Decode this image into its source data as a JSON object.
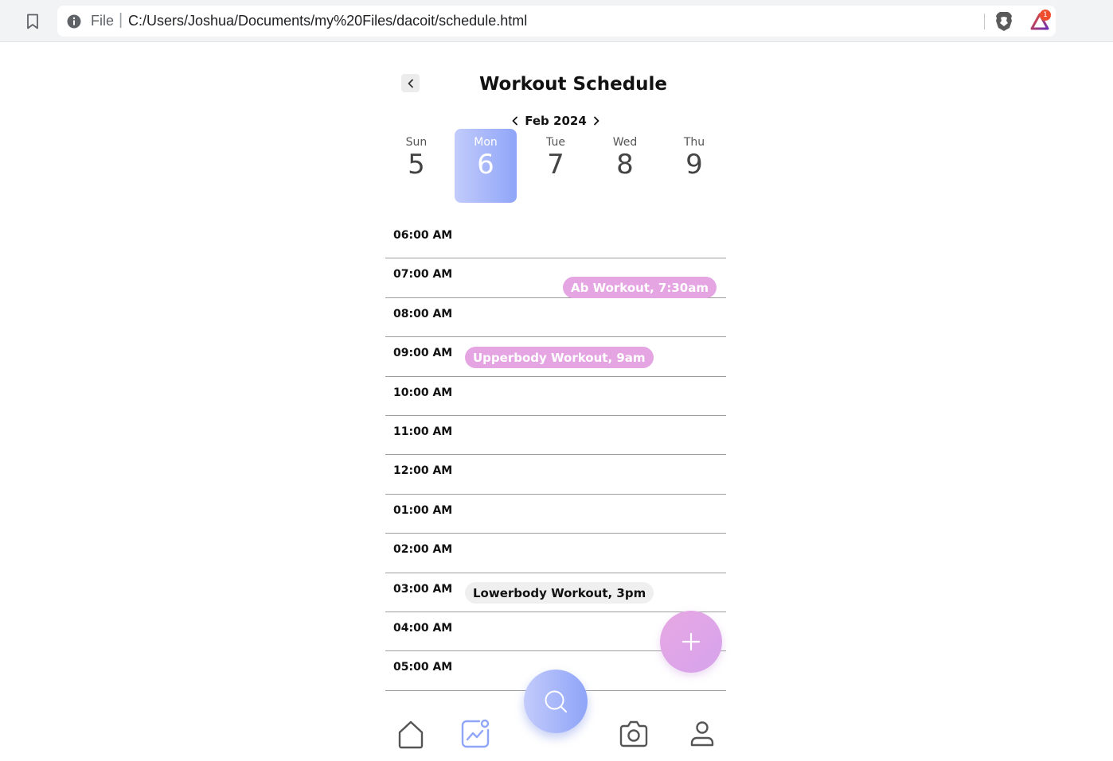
{
  "browser": {
    "scheme": "File",
    "separator": "|",
    "url": "C:/Users/Joshua/Documents/my%20Files/dacoit/schedule.html",
    "rewards_badge": "1"
  },
  "header": {
    "title": "Workout Schedule",
    "back_icon": "chevron-left-icon"
  },
  "calendar": {
    "month": "Feb 2024",
    "days": [
      {
        "name": "Sun",
        "num": "5",
        "active": false
      },
      {
        "name": "Mon",
        "num": "6",
        "active": true
      },
      {
        "name": "Tue",
        "num": "7",
        "active": false
      },
      {
        "name": "Wed",
        "num": "8",
        "active": false
      },
      {
        "name": "Thu",
        "num": "9",
        "active": false
      }
    ]
  },
  "timeline": {
    "slots": [
      "06:00 AM",
      "07:00 AM",
      "08:00 AM",
      "09:00 AM",
      "10:00 AM",
      "11:00 AM",
      "12:00 AM",
      "01:00 AM",
      "02:00 AM",
      "03:00 AM",
      "04:00 AM",
      "05:00 AM"
    ]
  },
  "events": [
    {
      "label": "Ab Workout, 7:30am",
      "style": "pink"
    },
    {
      "label": "Upperbody Workout, 9am",
      "style": "pink"
    },
    {
      "label": "Lowerbody Workout, 3pm",
      "style": "grey"
    }
  ],
  "actions": {
    "add_label": "+"
  },
  "bottom_nav": [
    {
      "icon": "home-icon"
    },
    {
      "icon": "activity-chart-icon",
      "active": true
    },
    {
      "icon": "search-icon"
    },
    {
      "icon": "camera-icon"
    },
    {
      "icon": "profile-icon"
    }
  ],
  "colors": {
    "accent_blue": "#8fa5f8",
    "accent_pink": "#e4a5e2",
    "nav_active": "#8fa5f8",
    "nav_inactive": "#555555"
  }
}
